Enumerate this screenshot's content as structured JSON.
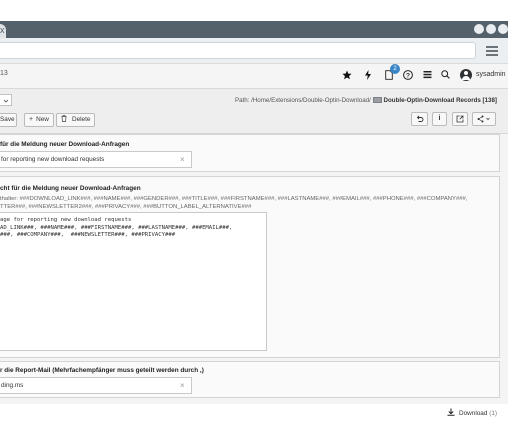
{
  "browser": {
    "tab_close": "x",
    "menu_icon": "hamburger-icon"
  },
  "header": {
    "crumb": "13",
    "notification_count": "2",
    "username": "sysadmin",
    "icons": [
      "star-icon",
      "bolt-icon",
      "file-icon",
      "help-icon",
      "grid-icon",
      "search-icon",
      "user-avatar-icon"
    ]
  },
  "docheader": {
    "select_value": "",
    "path_prefix": "Path: /Home/Extensions/Double-Optin-Download/",
    "path_record": "Double-Optin-Download Records [138]",
    "save_label": "Save",
    "new_label": "New",
    "delete_label": "Delete",
    "save_icon": "save-icon",
    "new_icon": "plus-icon",
    "delete_icon": "trash-icon",
    "right_buttons": [
      "undo-icon",
      "info-icon",
      "external-link-icon",
      "share-icon"
    ],
    "info_label": "i"
  },
  "form": {
    "subject_label": "für die Meldung neuer Download-Anfragen",
    "subject_value": "for reporting new download requests",
    "body_label": "cht für die Meldung neuer Download-Anfragen",
    "body_help_1": "thalter: ###DOWNLOAD_LINK###, ###NAME###, ###GENDER###, ###TITLE###, ###FIRSTNAME###, ###LASTNAME###, ###EMAIL###, ###PHONE###, ###COMPANY###,",
    "body_help_2": "TTER###, ###NEWSLETTER2###, ###PRIVACY###, ###BUTTON_LABEL_ALTERNATIVE###",
    "body_lines": [
      "age for reporting new download requests",
      "AD_LINK###, ###NAME###, ###FIRSTNAME###, ###LASTNAME###, ###EMAIL###,",
      "###, ###COMPANY###,  ###NEWSLETTER###, ###PRIVACY###"
    ],
    "report_label": "r die Report-Mail (Mehrfachempfänger muss geteilt werden durch ,)",
    "report_value": "ding.ms",
    "clear": "×"
  },
  "footer": {
    "download_label": "Download",
    "download_count": "(1)"
  }
}
